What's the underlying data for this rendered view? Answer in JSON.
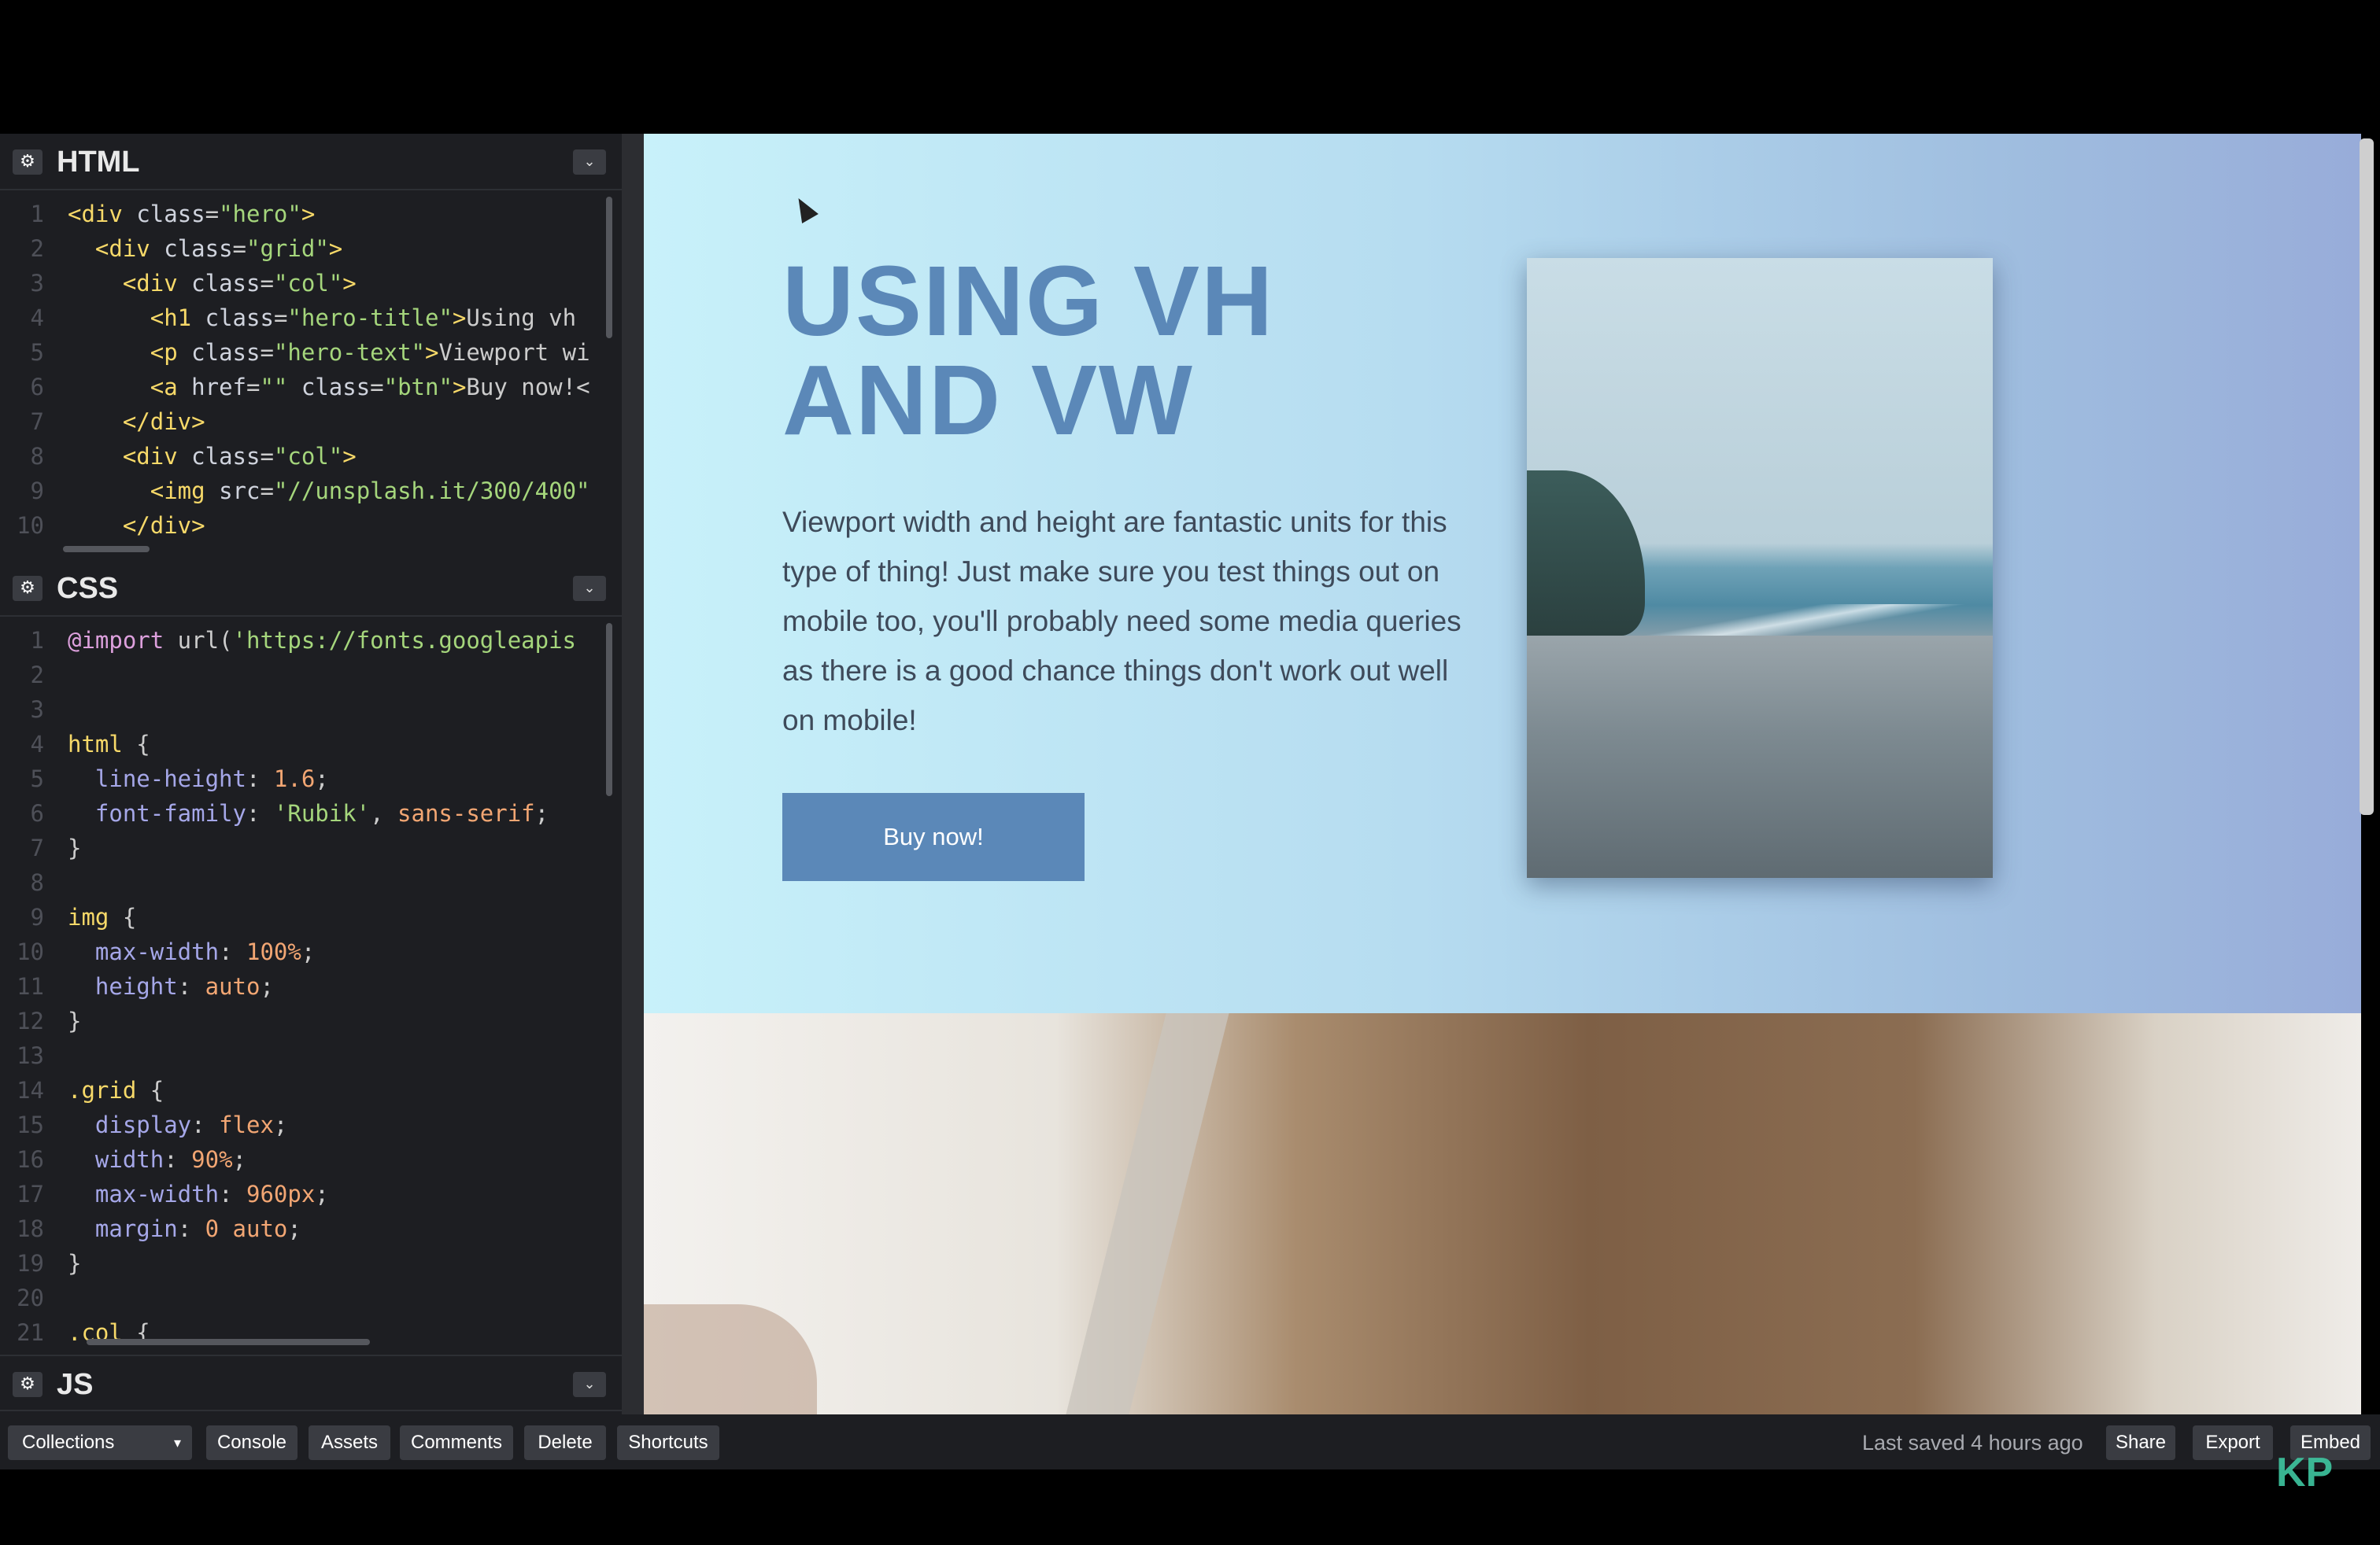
{
  "html_panel": {
    "title": "HTML",
    "lines": [
      {
        "n": "1",
        "html": "<span class='tag'>&lt;div</span> <span class='attr'>class</span>=<span class='str'>\"hero\"</span><span class='tag'>&gt;</span>"
      },
      {
        "n": "2",
        "html": "  <span class='tag'>&lt;div</span> <span class='attr'>class</span>=<span class='str'>\"grid\"</span><span class='tag'>&gt;</span>"
      },
      {
        "n": "3",
        "html": "    <span class='tag'>&lt;div</span> <span class='attr'>class</span>=<span class='str'>\"col\"</span><span class='tag'>&gt;</span>"
      },
      {
        "n": "4",
        "html": "      <span class='tag'>&lt;h1</span> <span class='attr'>class</span>=<span class='str'>\"hero-title\"</span><span class='tag'>&gt;</span>Using vh"
      },
      {
        "n": "5",
        "html": "      <span class='tag'>&lt;p</span> <span class='attr'>class</span>=<span class='str'>\"hero-text\"</span><span class='tag'>&gt;</span>Viewport wi"
      },
      {
        "n": "6",
        "html": "      <span class='tag'>&lt;a</span> <span class='attr'>href</span>=<span class='str'>\"\"</span> <span class='attr'>class</span>=<span class='str'>\"btn\"</span><span class='tag'>&gt;</span>Buy now!&lt;"
      },
      {
        "n": "7",
        "html": "    <span class='tag'>&lt;/div&gt;</span>"
      },
      {
        "n": "8",
        "html": "    <span class='tag'>&lt;div</span> <span class='attr'>class</span>=<span class='str'>\"col\"</span><span class='tag'>&gt;</span>"
      },
      {
        "n": "9",
        "html": "      <span class='tag'>&lt;img</span> <span class='attr'>src</span>=<span class='str'>\"//unsplash.it/300/400\"</span>"
      },
      {
        "n": "10",
        "html": "    <span class='tag'>&lt;/div&gt;</span>"
      }
    ]
  },
  "css_panel": {
    "title": "CSS",
    "lines": [
      {
        "n": "1",
        "html": "<span class='at'>@import</span> url(<span class='str'>'https://fonts.googleapis</span>"
      },
      {
        "n": "2",
        "html": ""
      },
      {
        "n": "3",
        "html": ""
      },
      {
        "n": "4",
        "html": "<span class='sel'>html</span> {"
      },
      {
        "n": "5",
        "html": "  <span class='prop'>line-height</span>: <span class='val'>1.6</span>;"
      },
      {
        "n": "6",
        "html": "  <span class='prop'>font-family</span>: <span class='str'>'Rubik'</span>, <span class='val'>sans-serif</span>;"
      },
      {
        "n": "7",
        "html": "}"
      },
      {
        "n": "8",
        "html": ""
      },
      {
        "n": "9",
        "html": "<span class='sel'>img</span> {"
      },
      {
        "n": "10",
        "html": "  <span class='prop'>max-width</span>: <span class='val'>100%</span>;"
      },
      {
        "n": "11",
        "html": "  <span class='prop'>height</span>: <span class='val'>auto</span>;"
      },
      {
        "n": "12",
        "html": "}"
      },
      {
        "n": "13",
        "html": ""
      },
      {
        "n": "14",
        "html": "<span class='sel'>.grid</span> {"
      },
      {
        "n": "15",
        "html": "  <span class='prop'>display</span>: <span class='val'>flex</span>;"
      },
      {
        "n": "16",
        "html": "  <span class='prop'>width</span>: <span class='val'>90%</span>;"
      },
      {
        "n": "17",
        "html": "  <span class='prop'>max-width</span>: <span class='val'>960px</span>;"
      },
      {
        "n": "18",
        "html": "  <span class='prop'>margin</span>: <span class='val'>0</span> <span class='val'>auto</span>;"
      },
      {
        "n": "19",
        "html": "}"
      },
      {
        "n": "20",
        "html": ""
      },
      {
        "n": "21",
        "html": "<span class='sel'>.col</span> {"
      }
    ]
  },
  "js_panel": {
    "title": "JS"
  },
  "preview": {
    "hero_title": "USING VH AND VW",
    "hero_text": "Viewport width and height are fantastic units for this type of thing! Just make sure you test things out on mobile too, you'll probably need some media queries as there is a good chance things don't work out well on mobile!",
    "button_label": "Buy now!"
  },
  "toolbar": {
    "collections": "Collections",
    "dropdown_arrow": "▾",
    "buttons": [
      "Console",
      "Assets",
      "Comments",
      "Delete",
      "Shortcuts"
    ],
    "saved_text": "Last saved 4 hours ago",
    "right_buttons": [
      "Share",
      "Export",
      "Embed"
    ]
  },
  "watermark": "KP",
  "icons": {
    "gear": "gear-icon",
    "chevron": "chevron-down-icon"
  },
  "colors": {
    "accent": "#5b88b8",
    "editor_bg": "#1d1e22",
    "button_bg": "#3a3c42"
  }
}
